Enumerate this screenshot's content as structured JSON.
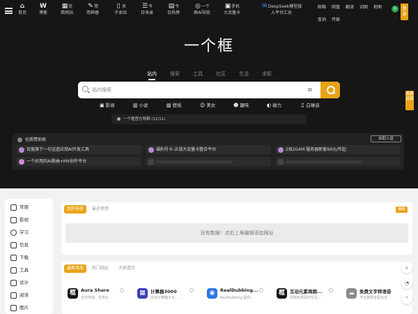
{
  "nav": {
    "items": [
      {
        "icon": "home-icon",
        "glyph": "⌂",
        "label": "首页",
        "label2": ""
      },
      {
        "icon": "wordpress-icon",
        "glyph": "W",
        "label": "博客",
        "label2": ""
      },
      {
        "icon": "grid-icon",
        "glyph": "▦",
        "label": "优",
        "label2": "质网站"
      },
      {
        "icon": "tools-icon",
        "glyph": "✎",
        "label": "常",
        "label2": "用神器"
      },
      {
        "icon": "mobile-icon",
        "glyph": "▯",
        "label": "关",
        "label2": "于本站"
      },
      {
        "icon": "calendar-icon",
        "glyph": "☰",
        "label": "今",
        "label2": "日收录"
      },
      {
        "icon": "chart-icon",
        "glyph": "▤",
        "label": "今",
        "label2": "日热榜"
      },
      {
        "icon": "ai-icon",
        "glyph": "◎",
        "label": "一个",
        "label2": "框AI导航"
      },
      {
        "icon": "sim-card-icon",
        "glyph": "▣",
        "label": "手机",
        "label2": "大流量卡"
      },
      {
        "icon": "deepseek-icon",
        "glyph": "✉",
        "label": "DeepSeek模型接",
        "label2": "入平台汇总"
      }
    ],
    "utils": [
      "邮箱",
      "网盘",
      "翻译",
      "词图",
      "地图",
      "查询",
      "传输"
    ],
    "go_badge": "G",
    "login_tab": "登录"
  },
  "title": "一个框",
  "search": {
    "tabs": [
      "站内",
      "搜索",
      "工具",
      "社区",
      "生活",
      "求职"
    ],
    "active_tab": "站内",
    "placeholder": "站内搜索"
  },
  "categories": [
    {
      "icon": "film-icon",
      "glyph": "▣",
      "label": "影视"
    },
    {
      "icon": "book-icon",
      "glyph": "▥",
      "label": "小说"
    },
    {
      "icon": "image-icon",
      "glyph": "▨",
      "label": "壁纸"
    },
    {
      "icon": "beauty-icon",
      "glyph": "☺",
      "label": "美女"
    },
    {
      "icon": "fun-icon",
      "glyph": "☻",
      "label": "趣味"
    },
    {
      "icon": "magnet-icon",
      "glyph": "◐",
      "label": "磁力"
    },
    {
      "icon": "sound-icon",
      "glyph": "♫",
      "label": "白噪音"
    }
  ],
  "notice": "一个框官方导群 (11/11)",
  "sponsor": {
    "title": "优质赞助商",
    "button": "自助入驻",
    "cards": [
      {
        "label": "百度旗下一句话造应用AI开发工具",
        "color": "#b589d6"
      },
      {
        "label": "福利号卡-正规大流量卡整合平台",
        "color": "#b589d6"
      },
      {
        "label": "2核2G4M 服务器新客99元/年起",
        "color": "#b589d6"
      },
      {
        "label": "一个好用的AI歌曲+MV创作平台",
        "color": "#d68ad6"
      },
      {
        "label": "",
        "color": ""
      },
      {
        "label": "",
        "color": ""
      }
    ]
  },
  "sidebar": [
    {
      "icon": "bookmark-icon",
      "label": "常用"
    },
    {
      "icon": "film-icon",
      "label": "影视"
    },
    {
      "icon": "graduation-icon",
      "label": "学习"
    },
    {
      "icon": "info-icon",
      "label": "信息"
    },
    {
      "icon": "download-icon",
      "label": "下载"
    },
    {
      "icon": "tool-icon",
      "label": "工具"
    },
    {
      "icon": "design-icon",
      "label": "设计"
    },
    {
      "icon": "read-icon",
      "label": "阅读"
    },
    {
      "icon": "picture-icon",
      "label": "图片"
    }
  ],
  "nav_panel": {
    "tabs": [
      "我的导航",
      "最近使用"
    ],
    "edit": "编辑",
    "empty": "没有数据！点右上角编辑添加网址"
  },
  "sites_panel": {
    "tabs": [
      "最新添加",
      "热门网址",
      "大家喜欢"
    ],
    "cards": [
      {
        "name": "Aura Share",
        "desc": "文件传输，优势分...",
        "logo": "框",
        "color": "#111111"
      },
      {
        "name": "计算器3000",
        "desc": "在线计算器大全，...",
        "logo": "▦",
        "color": "#3b3fb5"
      },
      {
        "name": "RealDubbing...",
        "desc": "RealDubbing 提供...",
        "logo": "◉",
        "color": "#2b78e4"
      },
      {
        "name": "互动元素周期...",
        "desc": "非常有意思的交互...",
        "logo": "框",
        "color": "#111111"
      },
      {
        "name": "免费文字转语音",
        "desc": "浮云梦配音是完全...",
        "logo": "☁",
        "color": "#8a8a8a"
      }
    ]
  },
  "floats": [
    "search-icon",
    "chart-icon",
    "up-arrow-icon"
  ],
  "side_tab": "我要投稿"
}
